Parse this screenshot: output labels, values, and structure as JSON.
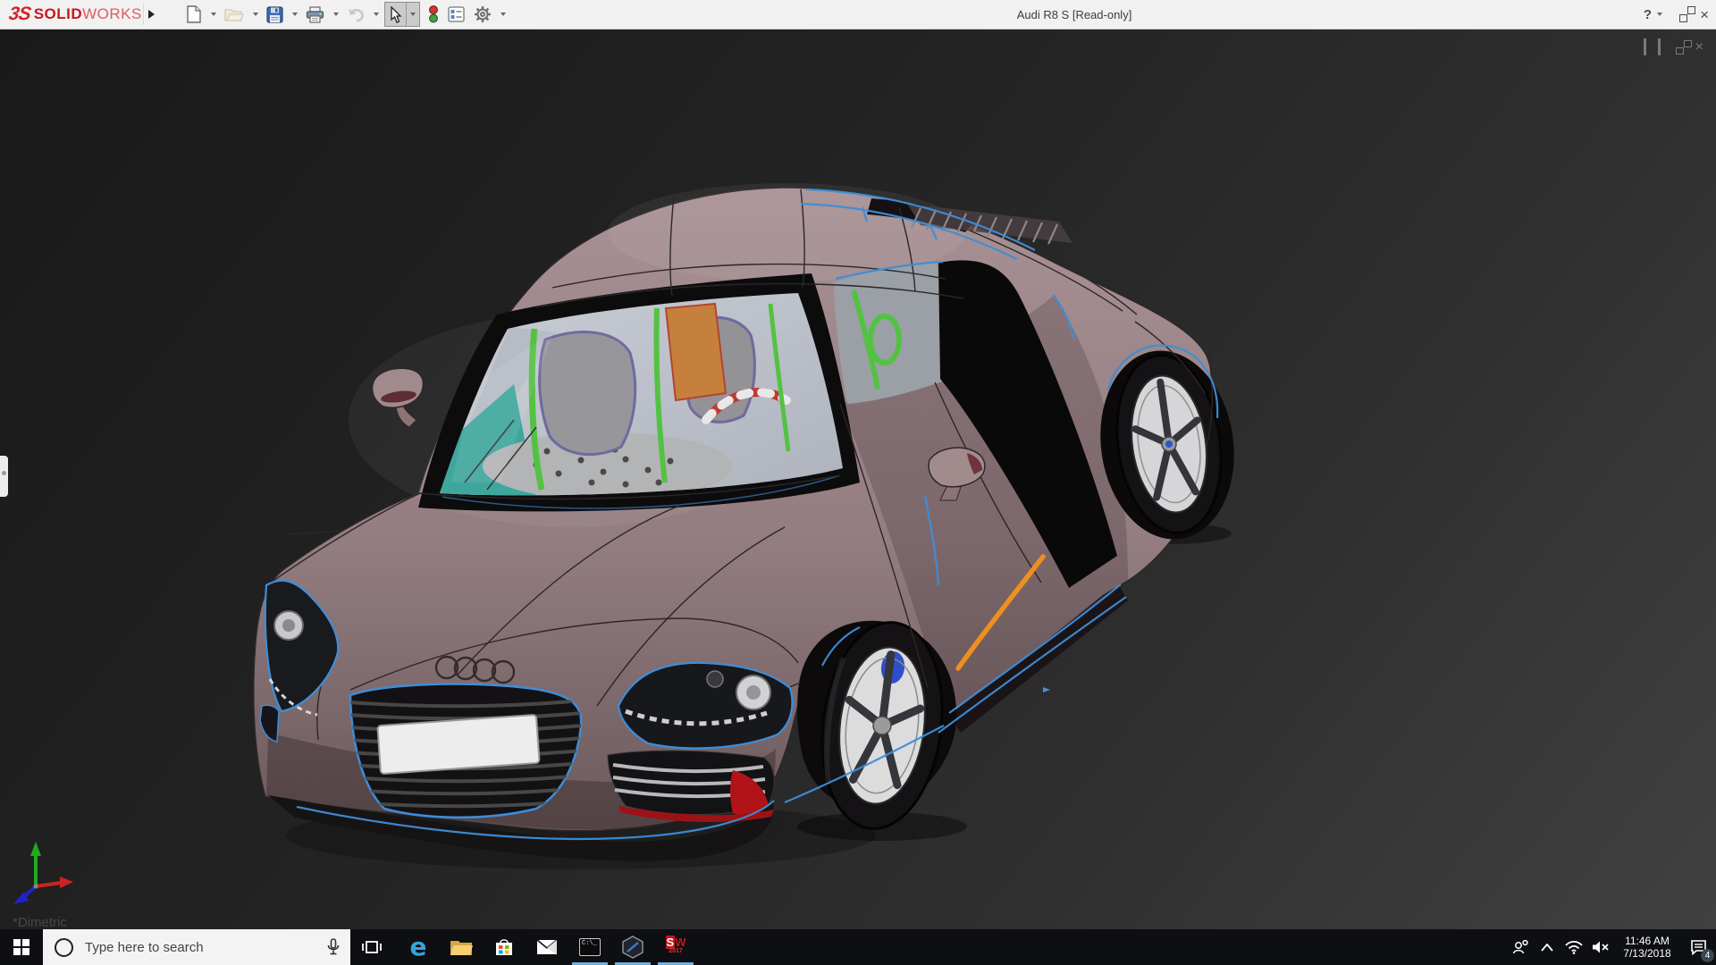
{
  "app": {
    "title": "Audi R8 S [Read-only]",
    "brand": {
      "mark": "3S",
      "bold": "SOLID",
      "light": "WORKS",
      "color": "#c8161d"
    },
    "toolbar_items": [
      {
        "name": "new-document",
        "dropdown": true
      },
      {
        "name": "open",
        "dropdown": true,
        "disabled": true
      },
      {
        "name": "save",
        "dropdown": true
      },
      {
        "name": "print",
        "dropdown": true
      },
      {
        "name": "undo",
        "dropdown": true,
        "disabled": true
      },
      {
        "name": "select",
        "dropdown": true,
        "active": true
      },
      {
        "name": "appearance-stoplight"
      },
      {
        "name": "display-settings"
      },
      {
        "name": "options-gear",
        "dropdown": true
      }
    ],
    "help_glyph": "?"
  },
  "viewport": {
    "view_label": "*Dimetric",
    "model_name": "Audi R8 S",
    "colors": {
      "body": "#9a8487",
      "edge_highlight_blue": "#3d8ed8",
      "selected_edge_orange": "#ef8f1f",
      "interior_trim_green": "#53c243",
      "interior_panel_orange": "#c5803e",
      "interior_dash_teal": "#3fa69e",
      "accent_red": "#b01418",
      "background_top": "#191919",
      "background_bottom": "#414141"
    },
    "triad_axes": [
      {
        "axis": "x",
        "color": "#cc2222"
      },
      {
        "axis": "y",
        "color": "#1faa1f"
      },
      {
        "axis": "z",
        "color": "#2222cc"
      }
    ]
  },
  "taskbar": {
    "search": {
      "placeholder": "Type here to search"
    },
    "apps": [
      {
        "name": "task-view"
      },
      {
        "name": "edge-browser"
      },
      {
        "name": "file-explorer"
      },
      {
        "name": "microsoft-store"
      },
      {
        "name": "mail"
      },
      {
        "name": "command-prompt",
        "running": true
      },
      {
        "name": "hexagon-app",
        "running": true
      },
      {
        "name": "solidworks-2017",
        "running": true
      }
    ],
    "glyphs": {
      "edge": "e",
      "cmd": "C:\\_",
      "sw": "SW",
      "sw_year": "2017"
    },
    "tray": {
      "icons": [
        "people",
        "chevron-up",
        "wifi",
        "volume-muted",
        "action-center"
      ],
      "time": "11:46 AM",
      "date": "7/13/2018",
      "notification_count": "4"
    }
  }
}
